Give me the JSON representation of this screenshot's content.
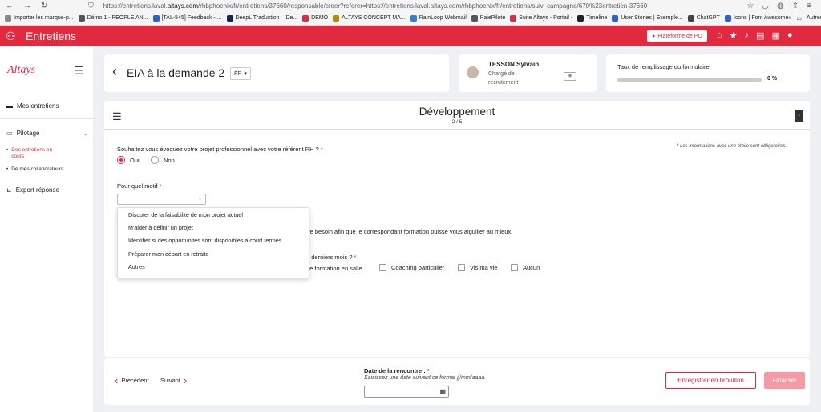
{
  "browser": {
    "url_prefix": "https://entretiens.laval.",
    "url_domain": "altays.com",
    "url_rest": "/rhbphoenix/fr/entretiens/37660/responsable/creer?referer=https://entretiens.laval.altays.com/rhbphoenix/fr/entretiens/suivi-campagne/670%23entretien-37660",
    "bookmarks": [
      {
        "label": "Importer les marque-p...",
        "color": "#888"
      },
      {
        "label": "Démo 1 - PEOPLE AN...",
        "color": "#555"
      },
      {
        "label": "[TAL-545] Feedback - ...",
        "color": "#2b62d9"
      },
      {
        "label": "DeepL Traduction – De...",
        "color": "#0f2b46"
      },
      {
        "label": "DEMO",
        "color": "#e1293f"
      },
      {
        "label": "ALTAYS CONCEPT MA...",
        "color": "#b48a00"
      },
      {
        "label": "RainLoop Webmail",
        "color": "#3a7bd5"
      },
      {
        "label": "PaiePilote",
        "color": "#555"
      },
      {
        "label": "Suite Altays - Portail -",
        "color": "#e1293f"
      },
      {
        "label": "Timeline",
        "color": "#222"
      },
      {
        "label": "User Stories | Exemple...",
        "color": "#2b62d9"
      },
      {
        "label": "ChatGPT",
        "color": "#444"
      },
      {
        "label": "Icons | Font Awesome",
        "color": "#2b62d9"
      }
    ],
    "bookmarks_more": "Autres marque-pages"
  },
  "header": {
    "title": "Entretiens",
    "platform_button": "Plateforme de PO"
  },
  "sidebar": {
    "brand": "Altays",
    "items": [
      {
        "label": "Mes entretiens"
      },
      {
        "label": "Pilotage"
      },
      {
        "label": "Export réponse"
      }
    ],
    "subitems": [
      {
        "label": "Des entretiens en cours"
      },
      {
        "label": "De mes collaborateurs"
      }
    ]
  },
  "interview": {
    "title": "EIA à la demande 2",
    "lang": "FR"
  },
  "person": {
    "name": "TESSON Sylvain",
    "role": "Chargé de recrutement"
  },
  "progress": {
    "label": "Taux de remplissage du formulaire",
    "value": 0,
    "text": "0 %"
  },
  "section": {
    "title": "Développement",
    "step": "2 / 5",
    "required_note": "* Les informations avec une étoile sont obligatoires.",
    "q1": "Souhaitez vous évoquez votre projet professionnel avec votre référent RH ?",
    "q1_options": [
      "Oui",
      "Non"
    ],
    "q1_selected": "Oui",
    "q2": "Pour quel motif",
    "dropdown_options": [
      "Discuter de la faisabilité de mon projet actuel",
      "M'aider à définir un projet",
      "Identifier si des opportunités sont disponibles à court termes",
      "Préparer mon départ en retraite",
      "Autres"
    ],
    "hint_partial": "tre besoin afin que le correspondant formation puisse vous aiguiller au mieux.",
    "q4_partial": "2 derniers mois ?",
    "checkbox_partial": "de formation en salle",
    "checkboxes": [
      "Coaching particulier",
      "Vis ma vie",
      "Aucun"
    ]
  },
  "footer": {
    "prev": "Précédent",
    "next": "Suivant",
    "date_label": "Date de la rencontre :",
    "date_hint": "Saisissez une date suivant ce format jj/mm/aaaa.",
    "save_draft": "Enregistrer en brouillon",
    "finalize": "Finaliser"
  },
  "colors": {
    "accent": "#e1293f"
  }
}
